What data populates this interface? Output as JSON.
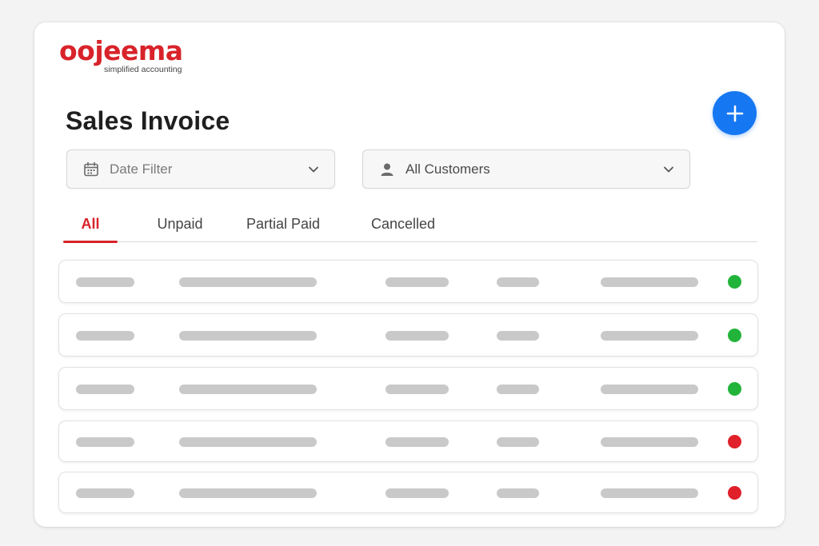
{
  "brand": {
    "name": "oojeema",
    "tagline": "simplified accounting",
    "color": "#d8232a"
  },
  "page": {
    "title": "Sales Invoice",
    "add_button_icon": "plus-icon",
    "accent": "#1677f2"
  },
  "filters": {
    "date": {
      "label": "Date Filter",
      "icon": "calendar-icon"
    },
    "customer": {
      "label": "All Customers",
      "icon": "user-icon"
    }
  },
  "tabs": [
    {
      "label": "All",
      "active": true
    },
    {
      "label": "Unpaid",
      "active": false
    },
    {
      "label": "Partial Paid",
      "active": false
    },
    {
      "label": "Cancelled",
      "active": false
    }
  ],
  "rows": [
    {
      "status": "paid",
      "status_color": "#22b43a"
    },
    {
      "status": "paid",
      "status_color": "#22b43a"
    },
    {
      "status": "paid",
      "status_color": "#22b43a"
    },
    {
      "status": "unpaid",
      "status_color": "#e0202a"
    },
    {
      "status": "unpaid",
      "status_color": "#e0202a"
    }
  ]
}
